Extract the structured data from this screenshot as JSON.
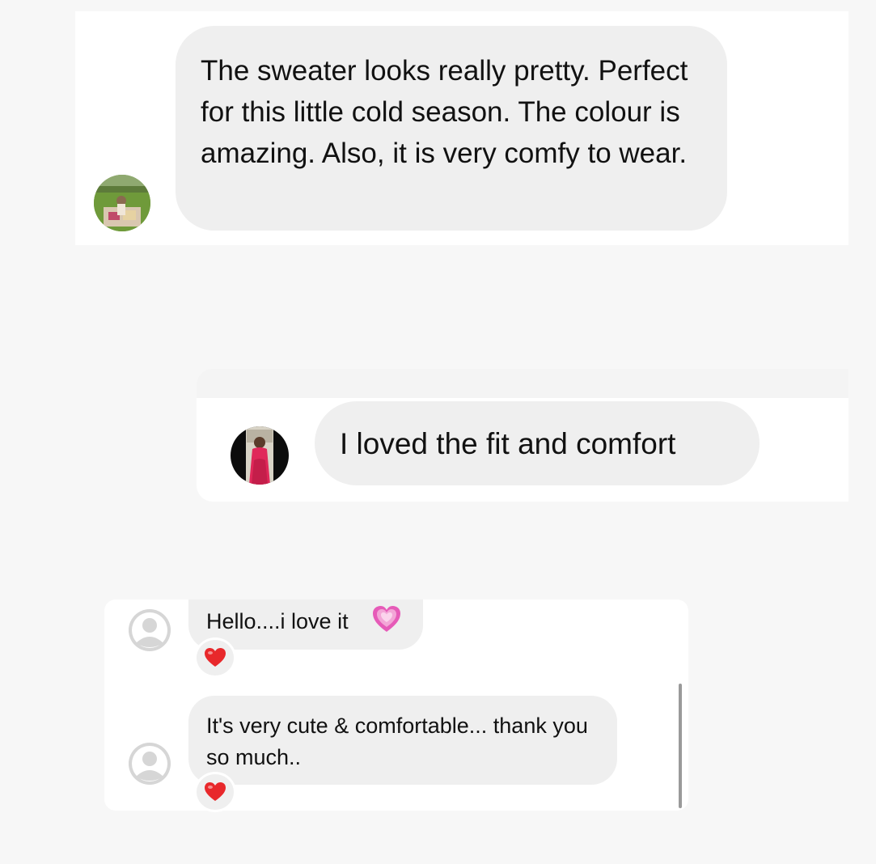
{
  "messages": [
    {
      "text": "The sweater looks really pretty. Perfect for this little cold season. The colour is amazing. Also, it is very comfy to wear.",
      "avatar_icon": "profile-photo-outdoor-picnic"
    },
    {
      "text": "I loved the fit and comfort",
      "avatar_icon": "profile-photo-red-dress"
    }
  ],
  "thread": {
    "items": [
      {
        "text": "Hello....i love it",
        "emoji_icon": "pink-heart-icon",
        "reaction_icon": "red-heart-icon",
        "avatar_icon": "default-user-icon"
      },
      {
        "text": "It's very cute & comfortable... thank you so much..",
        "reaction_icon": "red-heart-icon",
        "avatar_icon": "default-user-icon"
      }
    ]
  },
  "colors": {
    "background": "#f7f7f7",
    "panel": "#ffffff",
    "bubble": "#efefef",
    "heart_red": "#e8282b",
    "heart_pink": "#e65bb8"
  }
}
